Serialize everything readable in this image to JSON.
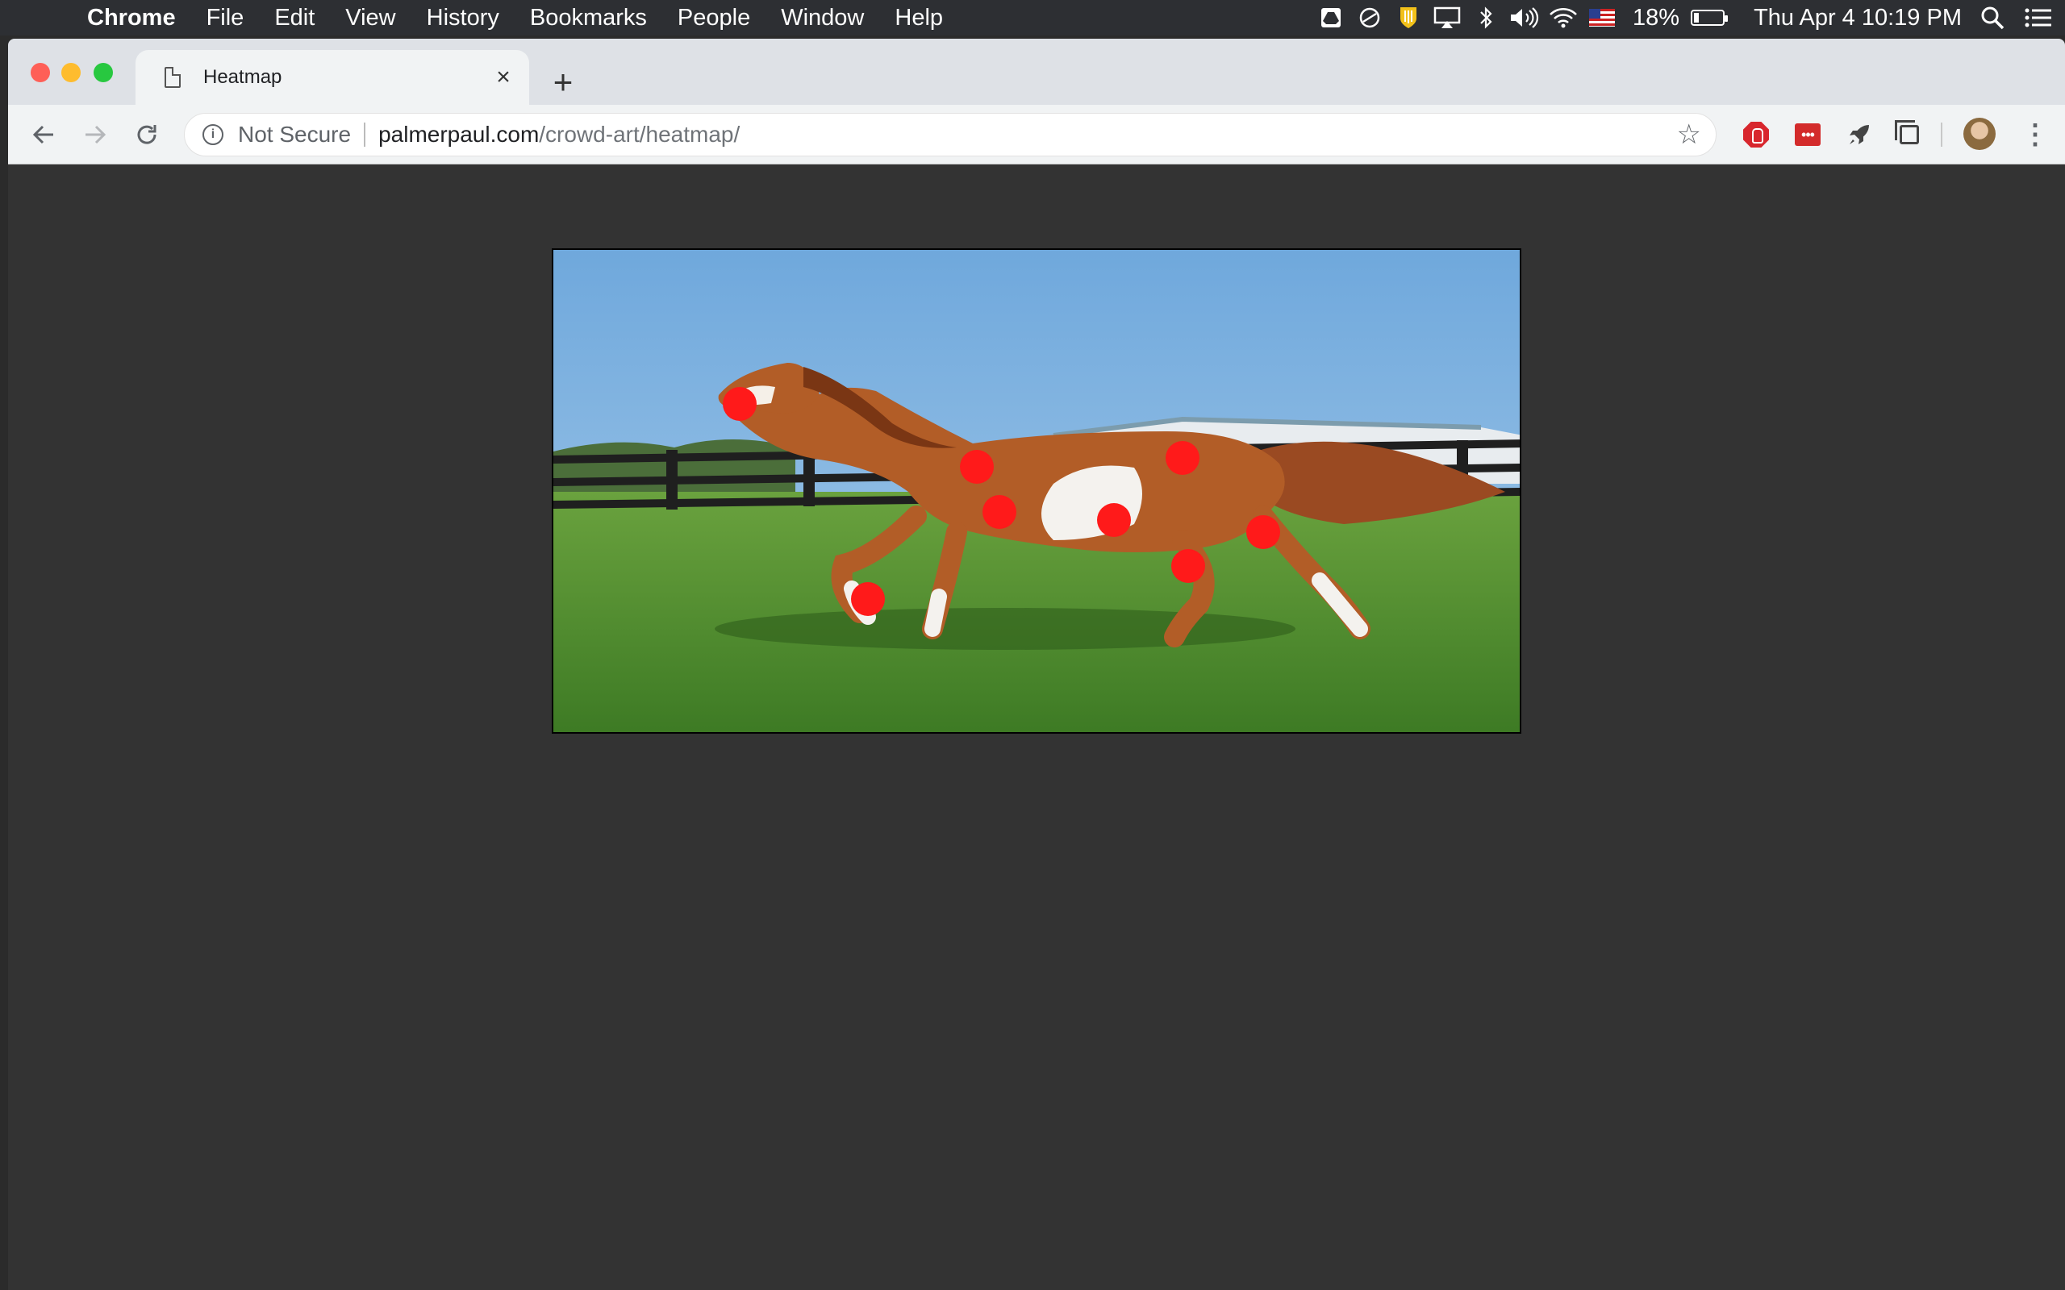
{
  "menubar": {
    "apple_icon": "apple-logo-icon",
    "app_name": "Chrome",
    "items": [
      "File",
      "Edit",
      "View",
      "History",
      "Bookmarks",
      "People",
      "Window",
      "Help"
    ],
    "battery_percent": "18%",
    "battery_level": 0.18,
    "datetime": "Thu Apr 4  10:19 PM",
    "status_icons": [
      "google-drive-icon",
      "sync-icon",
      "shield-extension-icon",
      "airplay-icon",
      "bluetooth-icon",
      "volume-icon",
      "wifi-icon",
      "us-flag-icon",
      "spotlight-search-icon",
      "notification-center-icon"
    ]
  },
  "browser": {
    "tab": {
      "title": "Heatmap",
      "close": "×"
    },
    "new_tab": "+",
    "security_label": "Not Secure",
    "url_host": "palmerpaul.com",
    "url_path": "/crowd-art/heatmap/",
    "extensions": [
      "adblock-icon",
      "lastpass-icon",
      "rocket-icon",
      "copy-tabs-icon"
    ]
  },
  "page": {
    "image_subject": "paint-horse-galloping-photo",
    "marker_color": "#ff1a1a"
  }
}
